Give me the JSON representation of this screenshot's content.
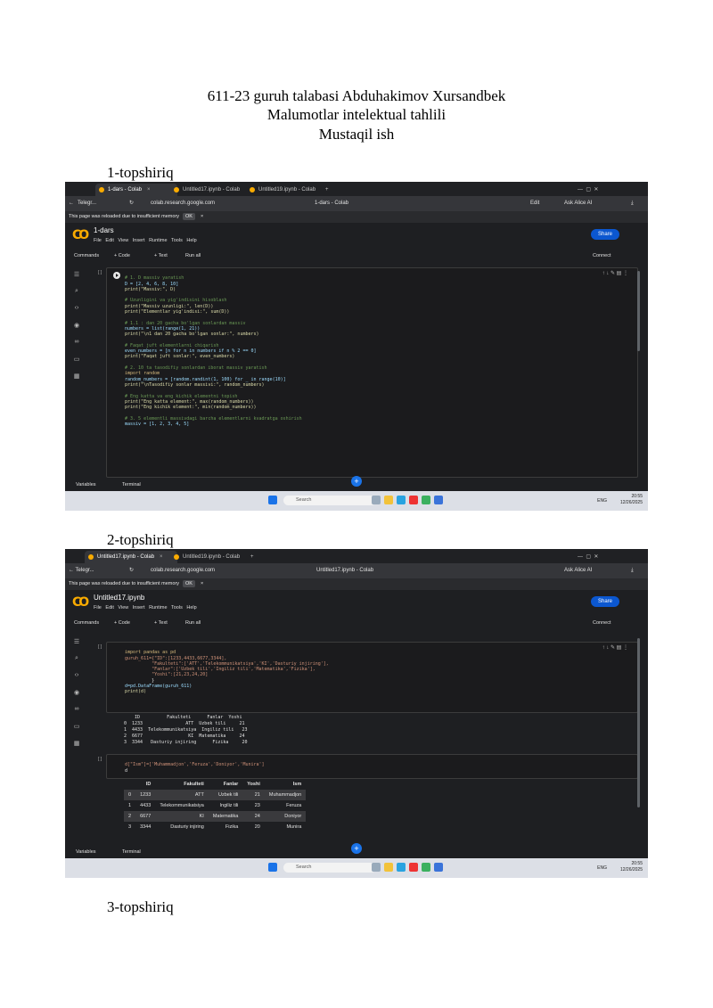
{
  "header": {
    "line1": "611-23 guruh talabasi Abduhakimov Xursandbek",
    "line2": "Malumotlar intelektual tahlili",
    "line3": "Mustaqil ish"
  },
  "tasks": [
    "1-topshiriq",
    "2-topshiriq",
    "3-topshiriq"
  ],
  "shot1": {
    "tabs": [
      "Telegr...",
      "1-dars - Colab",
      "Untitled17.ipynb - Colab",
      "Untitled19.ipynb - Colab"
    ],
    "url": "colab.research.google.com",
    "page_title": "1-dars - Colab",
    "edit_label": "Edit",
    "ask_label": "Ask Alice AI",
    "info": "This page was reloaded due to insufficient memory",
    "ok": "OK",
    "notebook_title": "1-dars",
    "menu": [
      "File",
      "Edit",
      "View",
      "Insert",
      "Runtime",
      "Tools",
      "Help"
    ],
    "share": "Share",
    "toolbar": [
      "Commands",
      "+ Code",
      "+ Text",
      "Run all"
    ],
    "connect": "Connect",
    "cell_index": "[ ]",
    "code": [
      "# 1. D massiv yaratish",
      "D = [2, 4, 6, 8, 10]",
      "print(\"Massiv:\", D)",
      "",
      "# Uzunligini va yig'indisini hisoblash",
      "print(\"Massiv uzunligi:\", len(D))",
      "print(\"Elementlar yig'indisi:\", sum(D))",
      "",
      "# 1.1 : dan 20 gacha bo'lgan sonlardan massiv",
      "numbers = list(range(1, 21))",
      "print(\"\\n1 dan 20 gacha bo'lgan sonlar:\", numbers)",
      "",
      "# Faqat juft elementlarni chiqarish",
      "even_numbers = [n for n in numbers if n % 2 == 0]",
      "print(\"Faqat juft sonlar:\", even_numbers)",
      "",
      "# 2. 10 ta tasodifiy sonlardan iborat massiv yaratish",
      "import random",
      "random_numbers = [random.randint(1, 100) for _ in range(10)]",
      "print(\"\\nTasodifiy sonlar massivi:\", random_numbers)",
      "",
      "# Eng katta va eng kichik elementni topish",
      "print(\"Eng katta element:\", max(random_numbers))",
      "print(\"Eng kichik element:\", min(random_numbers))",
      "",
      "# 3. 5 elementli massivdagi barcha elementlarni kvadratga oshirish",
      "massiv = [1, 2, 3, 4, 5]"
    ],
    "footer": [
      "Variables",
      "Terminal"
    ],
    "taskbar": {
      "search": "Search",
      "lang": "ENG",
      "time": "20:55",
      "date": "12/26/2025"
    }
  },
  "shot2": {
    "tabs": [
      "Untitled17.ipynb - Colab",
      "Untitled19.ipynb - Colab"
    ],
    "back": "← Telegr...",
    "url": "colab.research.google.com",
    "page_title": "Untitled17.ipynb - Colab",
    "ask_label": "Ask Alice AI",
    "info": "This page was reloaded due to insufficient memory",
    "ok": "OK",
    "notebook_title": "Untitled17.ipynb",
    "menu": [
      "File",
      "Edit",
      "View",
      "Insert",
      "Runtime",
      "Tools",
      "Help"
    ],
    "share": "Share",
    "toolbar": [
      "Commands",
      "+ Code",
      "+ Text",
      "Run all"
    ],
    "connect": "Connect",
    "cell1_index": "[ ]",
    "code1": [
      "import pandas as pd",
      "guruh_611={\"ID\":[1233,4433,6677,3344],",
      "          \"Fakulteti\":['ATT','Telekommunikatsiya','KI','Dasturiy injiring'],",
      "          \"Fanlar\":['Uzbek tili','Ingiliz tili','Matematika','Fizika'],",
      "          \"Yoshi\":[21,23,24,20]",
      "          }",
      "d=pd.DataFrame(guruh_611)",
      "print(d)"
    ],
    "output1": [
      "    ID          Fakulteti      Fanlar  Yoshi",
      "0  1233                ATT  Uzbek tili     21",
      "1  4433  Telekommunikatsiya  Ingiliz tili   23",
      "2  6677                 KI  Matematika     24",
      "3  3344   Dasturiy injiring      Fizika     20"
    ],
    "cell2_index": "[ ]",
    "code2": [
      "d[\"Ism\"]=['Muhammadjon','Feruza','Doniyor','Munira']",
      "d"
    ],
    "table": {
      "columns": [
        "",
        "ID",
        "Fakulteti",
        "Fanlar",
        "Yoshi",
        "Ism"
      ],
      "rows": [
        [
          "0",
          "1233",
          "ATT",
          "Uzbek tili",
          "21",
          "Muhammadjon"
        ],
        [
          "1",
          "4433",
          "Telekommunikatsiya",
          "Ingiliz tili",
          "23",
          "Feruza"
        ],
        [
          "2",
          "6677",
          "KI",
          "Matematika",
          "24",
          "Doniyor"
        ],
        [
          "3",
          "3344",
          "Dasturiy injiring",
          "Fizika",
          "20",
          "Munira"
        ]
      ]
    },
    "footer": [
      "Variables",
      "Terminal"
    ],
    "taskbar": {
      "search": "Search",
      "lang": "ENG",
      "time": "20:55",
      "date": "12/26/2025"
    }
  }
}
